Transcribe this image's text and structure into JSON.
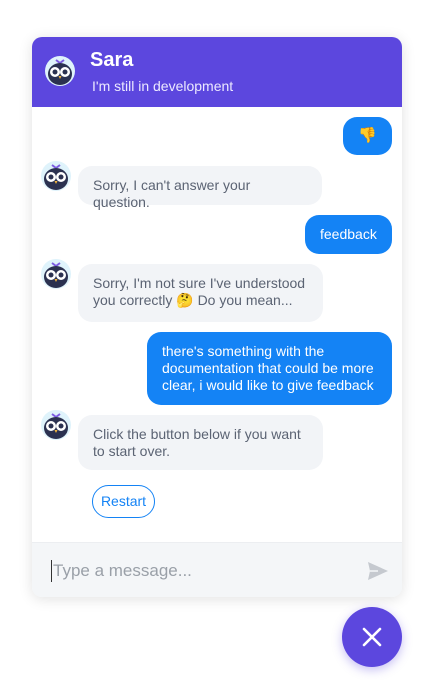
{
  "header": {
    "title": "Sara",
    "subtitle": "I'm still in development",
    "avatar_icon": "owl-avatar-icon"
  },
  "messages": [
    {
      "from": "user",
      "text": "👎"
    },
    {
      "from": "bot",
      "text": "Sorry, I can't answer your question."
    },
    {
      "from": "user",
      "text": "feedback"
    },
    {
      "from": "bot",
      "line1": "Sorry, I'm not sure I've understood",
      "line2": "you correctly 🤔 Do you mean..."
    },
    {
      "from": "user",
      "line1": "there's something with the",
      "line2": "documentation that could be more",
      "line3": "clear, i would like to give feedback"
    },
    {
      "from": "bot",
      "line1": "Click the button below if you want",
      "line2": "to start over."
    }
  ],
  "quick_reply": {
    "label": "Restart"
  },
  "composer": {
    "placeholder": "Type a message...",
    "value": "",
    "send_icon": "send-icon"
  },
  "fab": {
    "icon": "close-icon"
  },
  "colors": {
    "brand": "#5c47de",
    "user_bubble": "#1483f5",
    "bot_bubble": "#f2f4f7",
    "bot_text": "#5b6373"
  }
}
